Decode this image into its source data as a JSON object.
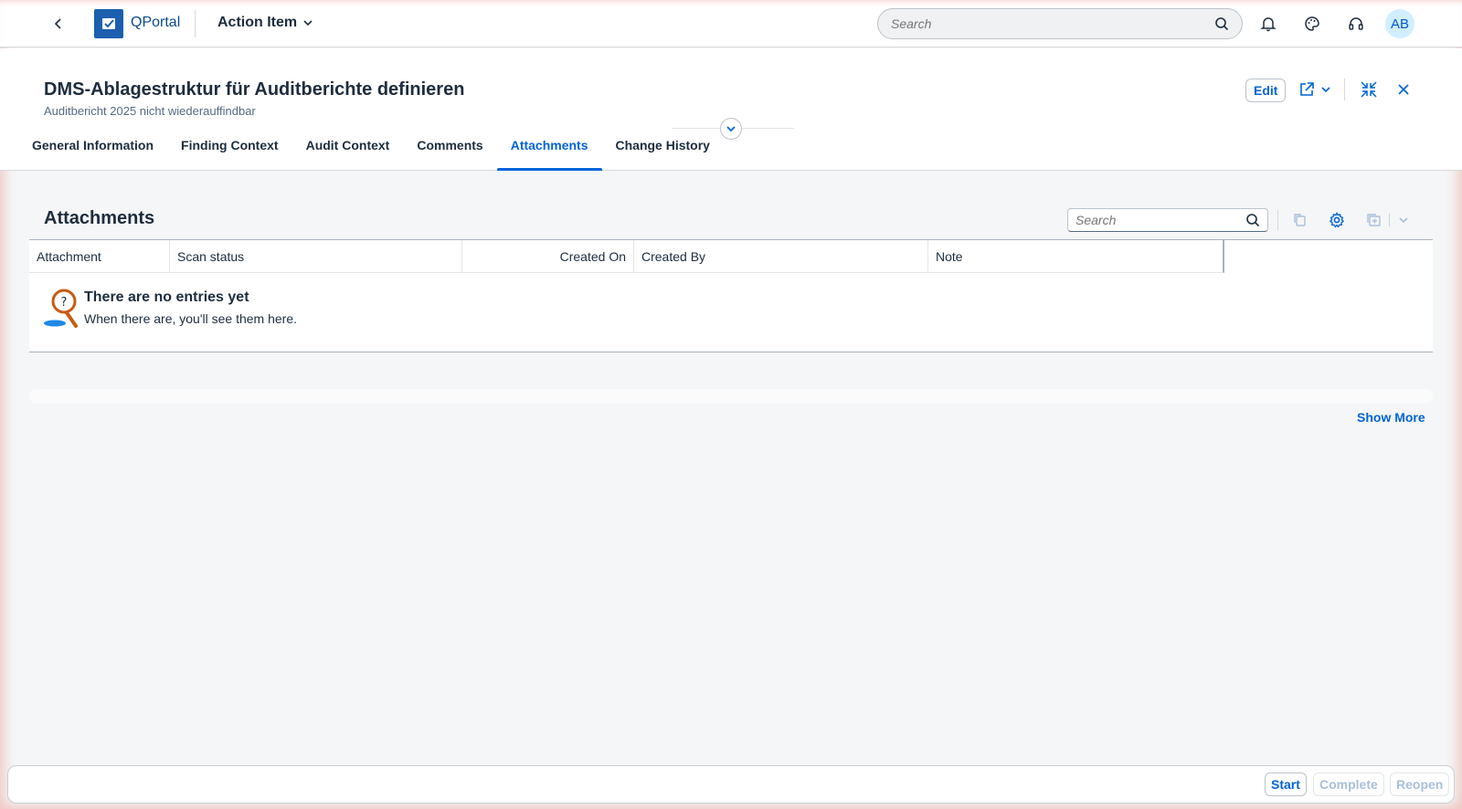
{
  "shell": {
    "app_name": "QPortal",
    "object_title": "Action Item",
    "search_placeholder": "Search",
    "avatar_initials": "AB"
  },
  "header": {
    "title": "DMS-Ablagestruktur für Auditberichte definieren",
    "subtitle": "Auditbericht 2025 nicht wiederauffindbar",
    "edit_label": "Edit"
  },
  "tabs": [
    {
      "label": "General Information",
      "active": false
    },
    {
      "label": "Finding Context",
      "active": false
    },
    {
      "label": "Audit Context",
      "active": false
    },
    {
      "label": "Comments",
      "active": false
    },
    {
      "label": "Attachments",
      "active": true
    },
    {
      "label": "Change History",
      "active": false
    }
  ],
  "attachments": {
    "title": "Attachments",
    "search_placeholder": "Search",
    "columns": [
      "Attachment",
      "Scan status",
      "Created On",
      "Created By",
      "Note"
    ],
    "empty_title": "There are no entries yet",
    "empty_text": "When there are, you'll see them here.",
    "show_more": "Show More"
  },
  "footer": {
    "start": "Start",
    "complete": "Complete",
    "reopen": "Reopen"
  },
  "colors": {
    "accent": "#0064d9",
    "logo_bg": "#1b5fae",
    "text": "#1d2d3e",
    "border_glow": "#f5dcd8"
  }
}
